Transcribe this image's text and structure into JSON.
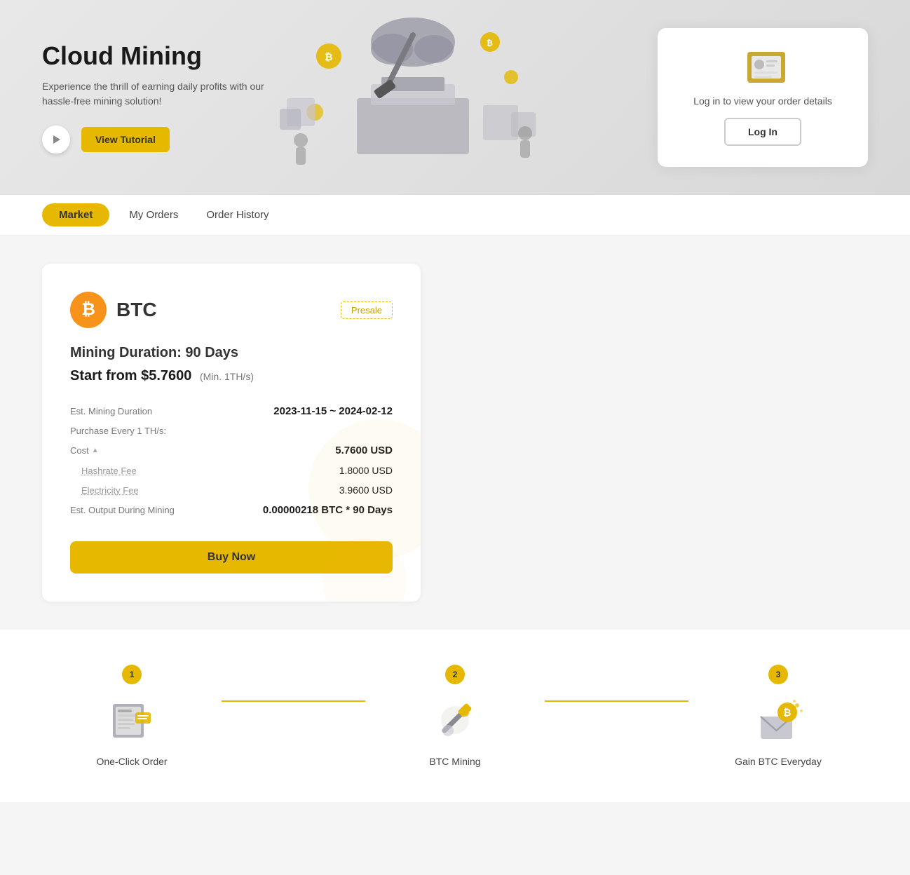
{
  "hero": {
    "title": "Cloud Mining",
    "subtitle": "Experience the thrill of earning daily profits with our hassle-free mining solution!",
    "tutorial_button": "View Tutorial"
  },
  "login_card": {
    "message": "Log in to view your order details",
    "button": "Log In"
  },
  "tabs": [
    {
      "id": "market",
      "label": "Market",
      "active": true
    },
    {
      "id": "my-orders",
      "label": "My Orders",
      "active": false
    },
    {
      "id": "order-history",
      "label": "Order History",
      "active": false
    }
  ],
  "mining_card": {
    "coin": "BTC",
    "badge": "Presale",
    "duration_label": "Mining Duration: 90 Days",
    "start_from_label": "Start from $5.7600",
    "min_label": "(Min. 1TH/s)",
    "est_duration_label": "Est. Mining Duration",
    "est_duration_value": "2023-11-15 ~ 2024-02-12",
    "purchase_label": "Purchase Every 1 TH/s:",
    "cost_label": "Cost",
    "cost_value": "5.7600 USD",
    "hashrate_label": "Hashrate Fee",
    "hashrate_value": "1.8000 USD",
    "electricity_label": "Electricity Fee",
    "electricity_value": "3.9600 USD",
    "output_label": "Est. Output During Mining",
    "output_value": "0.00000218 BTC * 90 Days",
    "buy_button": "Buy Now"
  },
  "steps": [
    {
      "number": "1",
      "label": "One-Click Order"
    },
    {
      "number": "2",
      "label": "BTC Mining"
    },
    {
      "number": "3",
      "label": "Gain BTC Everyday"
    }
  ]
}
